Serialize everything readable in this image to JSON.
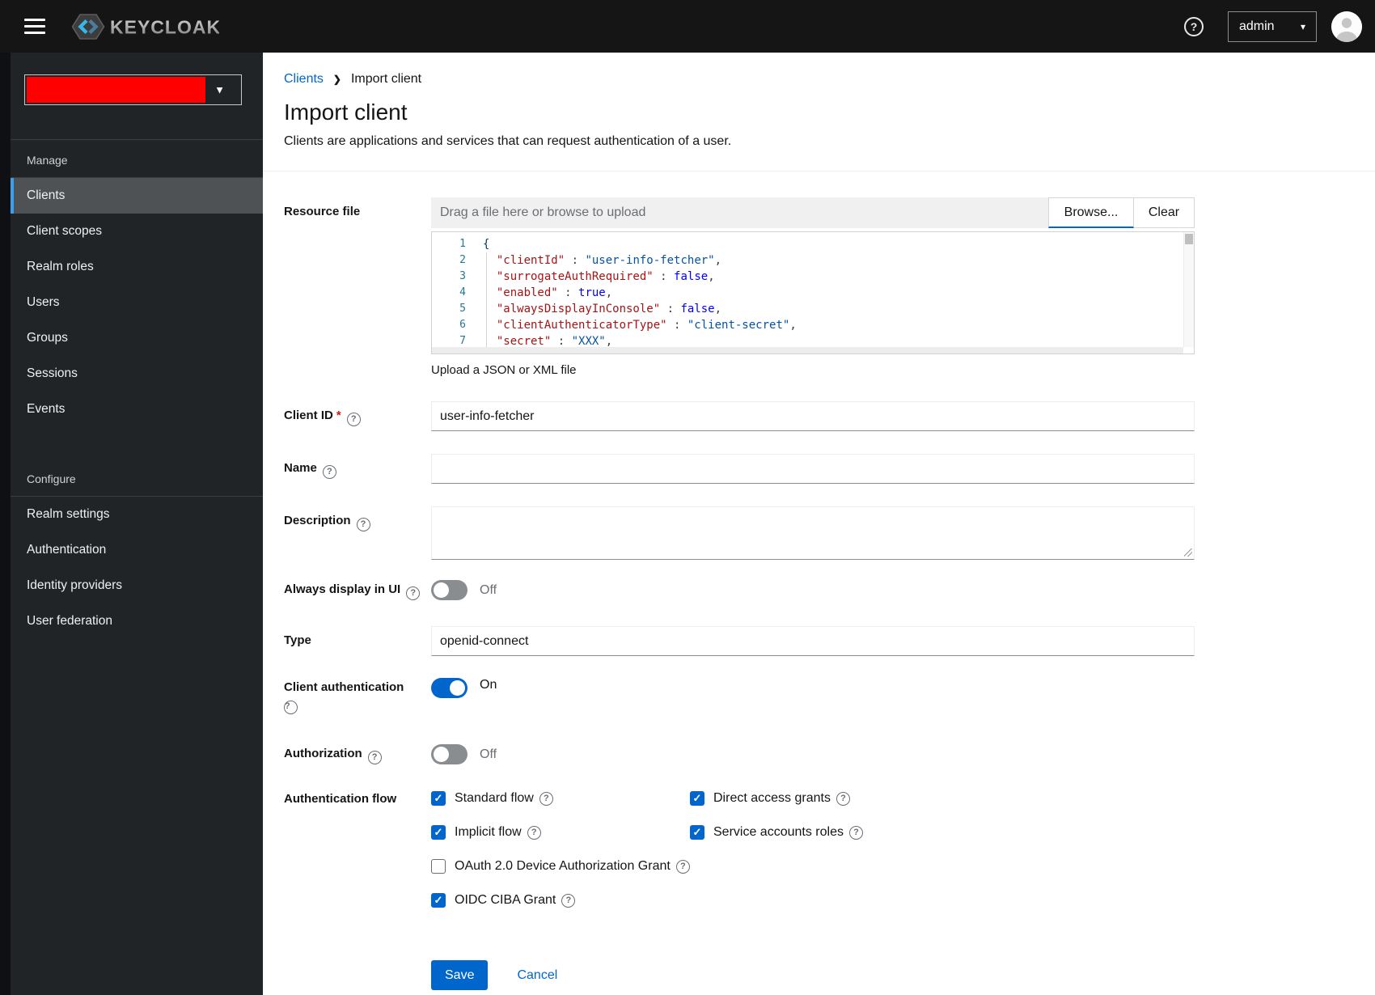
{
  "icons": {
    "help": "?",
    "caret_down": "▾",
    "realm_caret": "▼",
    "check": "✓",
    "breadcrumb_sep": "❯"
  },
  "colors": {
    "accent": "#0066cc",
    "masthead": "#151515",
    "sidebar": "#212427",
    "nav_selected": "#4f5255",
    "nav_selected_border": "#3a9fef",
    "realm_redacted": "#fe0000",
    "code_key": "#a31515",
    "code_string": "#0451a5",
    "code_bool": "#0000ff",
    "line_number": "#237893"
  },
  "header": {
    "brand": "KEYCLOAK",
    "user_menu": {
      "label": "admin"
    }
  },
  "sidebar": {
    "sections": [
      {
        "title": "Manage",
        "selected": "Clients",
        "items": [
          "Clients",
          "Client scopes",
          "Realm roles",
          "Users",
          "Groups",
          "Sessions",
          "Events"
        ]
      },
      {
        "title": "Configure",
        "selected": "",
        "items": [
          "Realm settings",
          "Authentication",
          "Identity providers",
          "User federation"
        ]
      }
    ]
  },
  "breadcrumb": {
    "link": "Clients",
    "current": "Import client"
  },
  "page": {
    "title": "Import client",
    "subtitle": "Clients are applications and services that can request authentication of a user."
  },
  "form": {
    "resource_file": {
      "label": "Resource file",
      "placeholder": "Drag a file here or browse to upload",
      "browse_label": "Browse...",
      "clear_label": "Clear",
      "helper": "Upload a JSON or XML file"
    },
    "client_id": {
      "label": "Client ID",
      "required": "*",
      "value": "user-info-fetcher"
    },
    "name": {
      "label": "Name",
      "value": ""
    },
    "description": {
      "label": "Description",
      "value": ""
    },
    "always_display_in_ui": {
      "label": "Always display in UI",
      "state": "Off"
    },
    "type": {
      "label": "Type",
      "value": "openid-connect"
    },
    "client_authentication": {
      "label": "Client authentication",
      "state": "On"
    },
    "authorization": {
      "label": "Authorization",
      "state": "Off"
    },
    "authentication_flow": {
      "label": "Authentication flow",
      "options": [
        {
          "label": "Standard flow",
          "checked": true,
          "wide": false
        },
        {
          "label": "Direct access grants",
          "checked": true,
          "wide": false
        },
        {
          "label": "Implicit flow",
          "checked": true,
          "wide": false
        },
        {
          "label": "Service accounts roles",
          "checked": true,
          "wide": false
        },
        {
          "label": "OAuth 2.0 Device Authorization Grant",
          "checked": false,
          "wide": true
        },
        {
          "label": "OIDC CIBA Grant",
          "checked": true,
          "wide": true
        }
      ]
    },
    "actions": {
      "save": "Save",
      "cancel": "Cancel"
    }
  },
  "editor": {
    "lines": [
      {
        "num": "1",
        "tokens": [
          {
            "text": "{",
            "type": "brace"
          }
        ]
      },
      {
        "num": "2",
        "tokens": [
          {
            "text": "  ",
            "type": "punct"
          },
          {
            "text": "\"clientId\"",
            "type": "key"
          },
          {
            "text": " : ",
            "type": "punct"
          },
          {
            "text": "\"user-info-fetcher\"",
            "type": "string"
          },
          {
            "text": ",",
            "type": "punct"
          }
        ]
      },
      {
        "num": "3",
        "tokens": [
          {
            "text": "  ",
            "type": "punct"
          },
          {
            "text": "\"surrogateAuthRequired\"",
            "type": "key"
          },
          {
            "text": " : ",
            "type": "punct"
          },
          {
            "text": "false",
            "type": "bool"
          },
          {
            "text": ",",
            "type": "punct"
          }
        ]
      },
      {
        "num": "4",
        "tokens": [
          {
            "text": "  ",
            "type": "punct"
          },
          {
            "text": "\"enabled\"",
            "type": "key"
          },
          {
            "text": " : ",
            "type": "punct"
          },
          {
            "text": "true",
            "type": "bool"
          },
          {
            "text": ",",
            "type": "punct"
          }
        ]
      },
      {
        "num": "5",
        "tokens": [
          {
            "text": "  ",
            "type": "punct"
          },
          {
            "text": "\"alwaysDisplayInConsole\"",
            "type": "key"
          },
          {
            "text": " : ",
            "type": "punct"
          },
          {
            "text": "false",
            "type": "bool"
          },
          {
            "text": ",",
            "type": "punct"
          }
        ]
      },
      {
        "num": "6",
        "tokens": [
          {
            "text": "  ",
            "type": "punct"
          },
          {
            "text": "\"clientAuthenticatorType\"",
            "type": "key"
          },
          {
            "text": " : ",
            "type": "punct"
          },
          {
            "text": "\"client-secret\"",
            "type": "string"
          },
          {
            "text": ",",
            "type": "punct"
          }
        ]
      },
      {
        "num": "7",
        "tokens": [
          {
            "text": "  ",
            "type": "punct"
          },
          {
            "text": "\"secret\"",
            "type": "key"
          },
          {
            "text": " : ",
            "type": "punct"
          },
          {
            "text": "\"XXX\"",
            "type": "string"
          },
          {
            "text": ",",
            "type": "punct"
          }
        ]
      }
    ]
  }
}
